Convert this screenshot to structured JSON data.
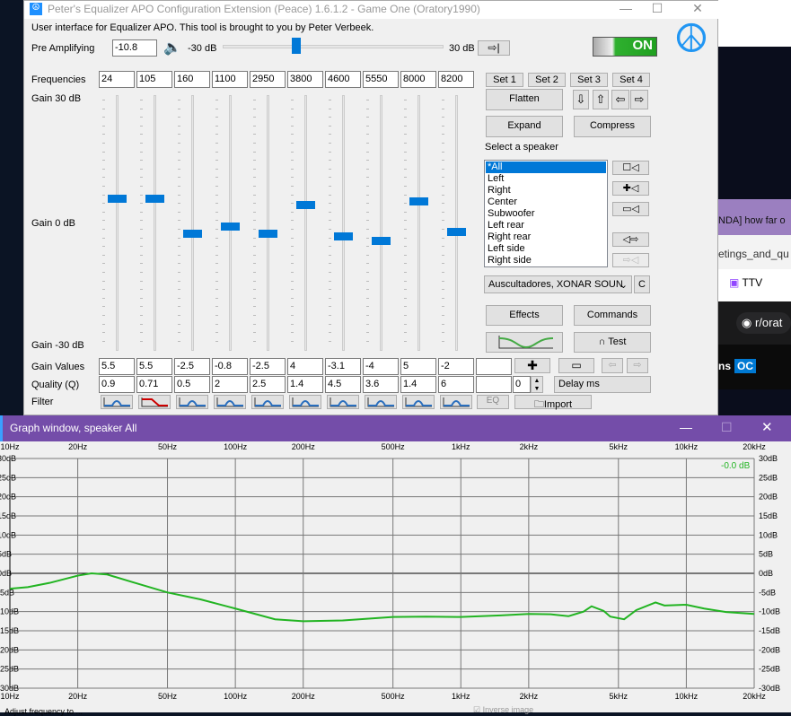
{
  "main_window": {
    "title": "Peter's Equalizer APO Configuration Extension (Peace) 1.6.1.2 - Game One (Oratory1990)",
    "minimize": "—",
    "maximize": "☐",
    "close": "✕",
    "intro": "User interface for Equalizer APO. This tool is brought to you by Peter Verbeek.",
    "pre_amp_label": "Pre Amplifying",
    "pre_amp_value": "-10.8",
    "pre_amp_min": "-30 dB",
    "pre_amp_max": "30 dB",
    "pre_amp_fraction": 0.33,
    "power_label": "ON",
    "frequencies_label": "Frequencies",
    "frequencies": [
      "24",
      "105",
      "160",
      "1100",
      "2950",
      "3800",
      "4600",
      "5550",
      "8000",
      "8200"
    ],
    "gain_top": "Gain 30 dB",
    "gain_mid": "Gain 0 dB",
    "gain_bottom": "Gain -30 dB",
    "gains": [
      5.5,
      5.5,
      -2.5,
      -0.8,
      -2.5,
      4,
      -3.1,
      -4,
      5,
      -2
    ],
    "gain_values_label": "Gain Values",
    "gain_values": [
      "5.5",
      "5.5",
      "-2.5",
      "-0.8",
      "-2.5",
      "4",
      "-3.1",
      "-4",
      "5",
      "-2",
      ""
    ],
    "quality_label": "Quality (Q)",
    "quality_values": [
      "0.9",
      "0.71",
      "0.5",
      "2",
      "2.5",
      "1.4",
      "4.5",
      "3.6",
      "1.4",
      "6",
      ""
    ],
    "filter_label": "Filter",
    "delay_value": "0",
    "delay_label": "Delay ms",
    "import_label": "Import",
    "sets": [
      "Set 1",
      "Set 2",
      "Set 3",
      "Set 4"
    ],
    "flatten": "Flatten",
    "expand": "Expand",
    "compress": "Compress",
    "select_speaker_label": "Select a speaker",
    "speakers": [
      "*All",
      "Left",
      "Right",
      "Center",
      "Subwoofer",
      "Left rear",
      "Right rear",
      "Left side",
      "Right side"
    ],
    "device": "Auscultadores, XONAR SOUN",
    "device_c": "C",
    "effects": "Effects",
    "commands": "Commands",
    "test": "Test"
  },
  "graph_window": {
    "title": "Graph window, speaker All",
    "minimize": "—",
    "maximize": "☐",
    "close": "✕",
    "readout": "-0.0 dB",
    "inverse_label": "Inverse image",
    "status": "Adjust frequency to ..."
  },
  "background": {
    "strip": "NDA] how far o",
    "url": "etings_and_qu",
    "tab": "TTV",
    "search": "r/orat",
    "post": "ns",
    "badge": "OC"
  },
  "chart_data": {
    "type": "line",
    "title": "Graph window, speaker All",
    "xscale": "log",
    "xlim": [
      10,
      20000
    ],
    "ylim": [
      -30,
      30
    ],
    "x_ticks": [
      10,
      20,
      50,
      100,
      200,
      500,
      1000,
      2000,
      5000,
      10000,
      20000
    ],
    "x_tick_labels": [
      "10Hz",
      "20Hz",
      "50Hz",
      "100Hz",
      "200Hz",
      "500Hz",
      "1kHz",
      "2kHz",
      "5kHz",
      "10kHz",
      "20kHz"
    ],
    "y_ticks": [
      30,
      25,
      20,
      15,
      10,
      5,
      0,
      -5,
      -10,
      -15,
      -20,
      -25,
      -30
    ],
    "y_tick_labels": [
      "30dB",
      "25dB",
      "20dB",
      "15dB",
      "10dB",
      "5dB",
      "0dB",
      "-5dB",
      "-10dB",
      "-15dB",
      "-20dB",
      "-25dB",
      "-30dB"
    ],
    "series": [
      {
        "name": "All",
        "color": "#22b422",
        "x": [
          10,
          12,
          15,
          20,
          23,
          27,
          35,
          50,
          70,
          100,
          150,
          200,
          300,
          500,
          700,
          1000,
          1500,
          2000,
          2500,
          3000,
          3500,
          3800,
          4300,
          4600,
          5300,
          6000,
          7300,
          8000,
          10000,
          12000,
          15000,
          20000
        ],
        "y": [
          -4,
          -3.6,
          -2.5,
          -0.6,
          0,
          -0.3,
          -2.3,
          -5,
          -6.8,
          -9.2,
          -12,
          -12.5,
          -12.3,
          -11.4,
          -11.3,
          -11.4,
          -11,
          -10.6,
          -10.7,
          -11.2,
          -10,
          -8.6,
          -9.8,
          -11.3,
          -12,
          -9.6,
          -7.6,
          -8.4,
          -8.2,
          -9.2,
          -10.1,
          -10.6
        ]
      }
    ]
  }
}
